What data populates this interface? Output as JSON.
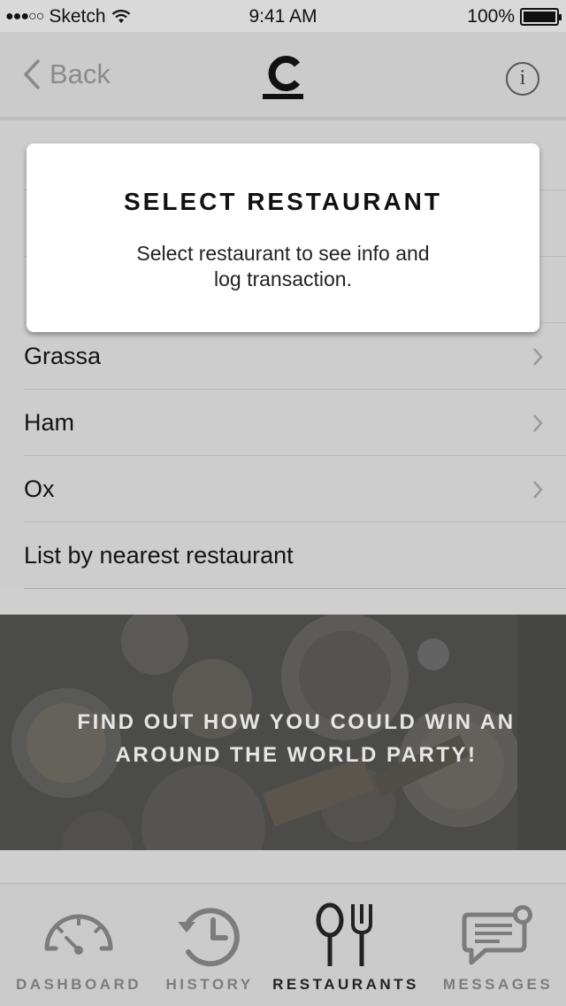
{
  "status_bar": {
    "carrier": "Sketch",
    "signal": "●●●○○",
    "time": "9:41 AM",
    "battery": "100%"
  },
  "nav": {
    "back_label": "Back",
    "logo_icon": "c-brand-logo",
    "info_icon": "info-icon"
  },
  "restaurants": [
    {
      "name": "Grassa",
      "chevron": true
    },
    {
      "name": "Ham",
      "chevron": true
    },
    {
      "name": "Ox",
      "chevron": true
    },
    {
      "name": "List by nearest restaurant",
      "chevron": false
    }
  ],
  "modal": {
    "title": "SELECT RESTAURANT",
    "body": "Select restaurant to see info and log transaction."
  },
  "banner": {
    "text_line1": "FIND OUT HOW YOU COULD WIN AN",
    "text_line2": "AROUND THE WORLD PARTY!"
  },
  "tabs": [
    {
      "label": "DASHBOARD",
      "icon": "gauge-icon",
      "active": false
    },
    {
      "label": "HISTORY",
      "icon": "history-clock-icon",
      "active": false
    },
    {
      "label": "RESTAURANTS",
      "icon": "fork-spoon-icon",
      "active": true
    },
    {
      "label": "MESSAGES",
      "icon": "message-bubble-icon",
      "active": false
    }
  ],
  "colors": {
    "background": "#cdcdcd",
    "modal": "#ffffff",
    "inactive_tab": "#7c7c7c",
    "active_tab": "#222222"
  }
}
